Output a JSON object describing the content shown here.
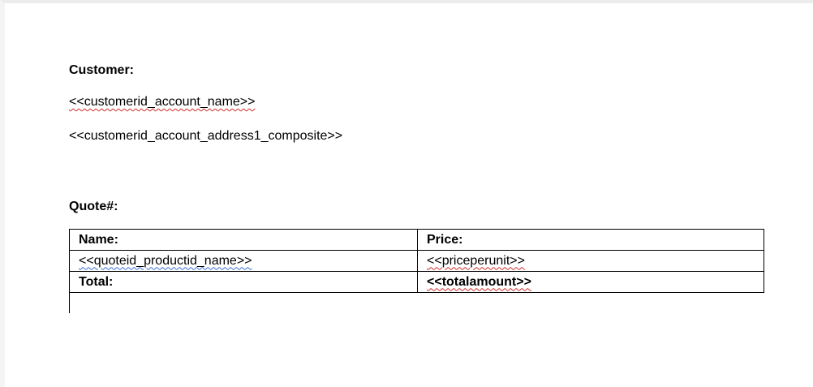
{
  "document": {
    "customer_heading": "Customer:",
    "customer_name_field": "<<customerid_account_name>>",
    "customer_address_field": "<<customerid_account_address1_composite>>",
    "quote_heading": "Quote#:",
    "table": {
      "header": {
        "name": "Name:",
        "price": "Price:"
      },
      "row": {
        "name": "<<quoteid_productid_name>>",
        "price": "<<priceperunit>>"
      },
      "total": {
        "label": "Total:",
        "value": "<<totalamount>>"
      }
    }
  }
}
